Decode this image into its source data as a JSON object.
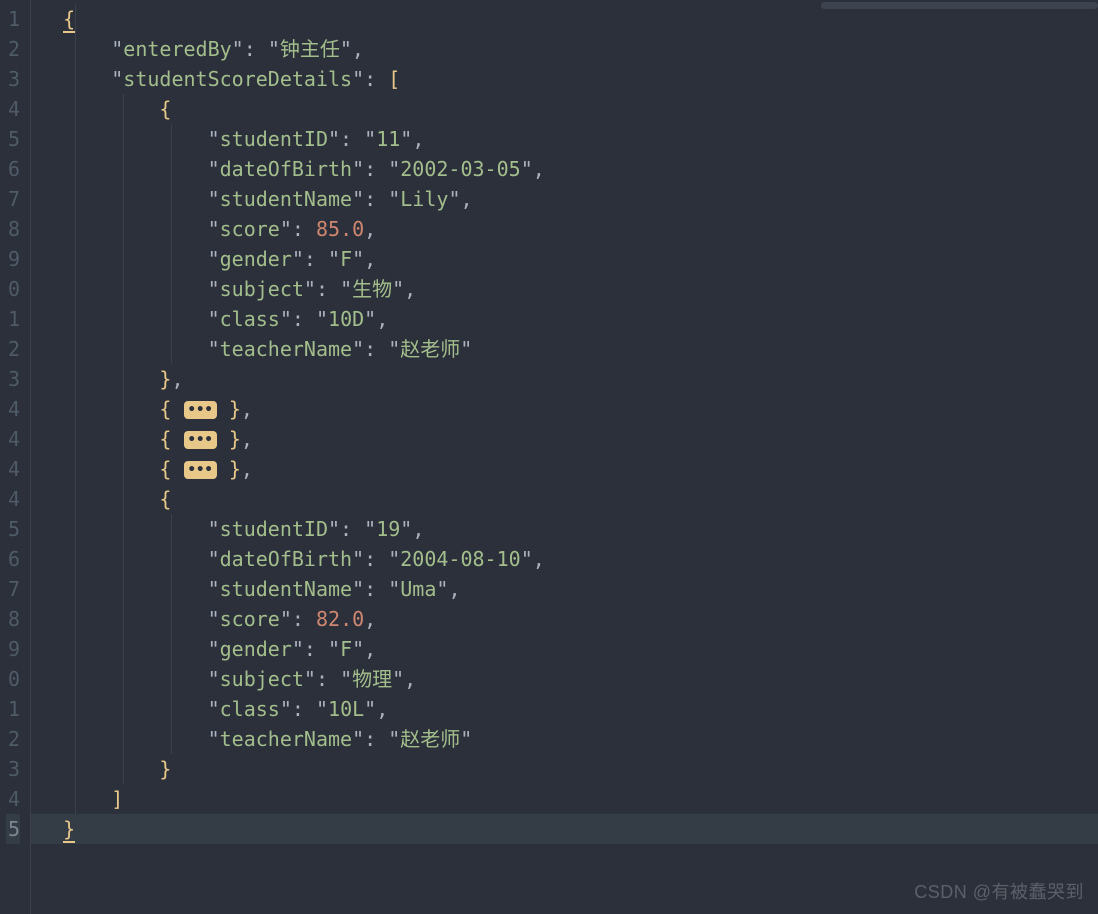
{
  "watermark": "CSDN @有被蠢哭到",
  "gutter": [
    "1",
    "2",
    "3",
    "4",
    "5",
    "6",
    "7",
    "8",
    "9",
    "0",
    "1",
    "2",
    "3",
    "4",
    "4",
    "4",
    "4",
    "5",
    "6",
    "7",
    "8",
    "9",
    "0",
    "1",
    "2",
    "3",
    "4",
    "5"
  ],
  "currentLine": 28,
  "foldBadge": "•••",
  "code": {
    "enteredBy": {
      "key": "enteredBy",
      "value": "钟主任"
    },
    "studentScoreDetails": {
      "key": "studentScoreDetails"
    },
    "obj1": {
      "studentID": {
        "key": "studentID",
        "value": "11"
      },
      "dateOfBirth": {
        "key": "dateOfBirth",
        "value": "2002-03-05"
      },
      "studentName": {
        "key": "studentName",
        "value": "Lily"
      },
      "score": {
        "key": "score",
        "value": "85.0"
      },
      "gender": {
        "key": "gender",
        "value": "F"
      },
      "subject": {
        "key": "subject",
        "value": "生物"
      },
      "class": {
        "key": "class",
        "value": "10D"
      },
      "teacherName": {
        "key": "teacherName",
        "value": "赵老师"
      }
    },
    "obj2": {
      "studentID": {
        "key": "studentID",
        "value": "19"
      },
      "dateOfBirth": {
        "key": "dateOfBirth",
        "value": "2004-08-10"
      },
      "studentName": {
        "key": "studentName",
        "value": "Uma"
      },
      "score": {
        "key": "score",
        "value": "82.0"
      },
      "gender": {
        "key": "gender",
        "value": "F"
      },
      "subject": {
        "key": "subject",
        "value": "物理"
      },
      "class": {
        "key": "class",
        "value": "10L"
      },
      "teacherName": {
        "key": "teacherName",
        "value": "赵老师"
      }
    }
  }
}
